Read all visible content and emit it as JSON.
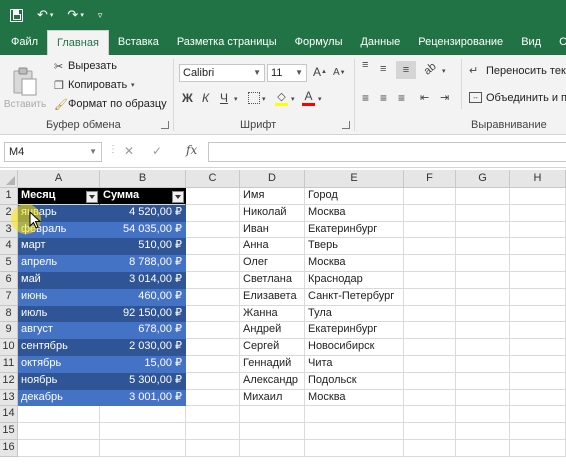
{
  "ribbon_tabs": [
    "Файл",
    "Главная",
    "Вставка",
    "Разметка страницы",
    "Формулы",
    "Данные",
    "Рецензирование",
    "Вид",
    "С"
  ],
  "active_tab": "Главная",
  "clipboard": {
    "paste": "Вставить",
    "cut": "Вырезать",
    "copy": "Копировать",
    "format_painter": "Формат по образцу",
    "label": "Буфер обмена"
  },
  "font": {
    "name": "Calibri",
    "size": "11",
    "bold": "Ж",
    "italic": "К",
    "underline": "Ч",
    "color_letter": "А",
    "label": "Шрифт"
  },
  "alignment": {
    "wrap": "Переносить текст",
    "merge": "Объединить и п",
    "label": "Выравнивание"
  },
  "formula_bar": {
    "name_box": "M4",
    "fx": "fx",
    "value": ""
  },
  "columns": [
    "A",
    "B",
    "C",
    "D",
    "E",
    "F",
    "G",
    "H"
  ],
  "rows": [
    "1",
    "2",
    "3",
    "4",
    "5",
    "6",
    "7",
    "8",
    "9",
    "10",
    "11",
    "12",
    "13",
    "14",
    "15",
    "16"
  ],
  "table": {
    "headers": [
      "Месяц",
      "Сумма"
    ],
    "rows": [
      [
        "январь",
        "4 520,00 ₽"
      ],
      [
        "февраль",
        "54 035,00 ₽"
      ],
      [
        "март",
        "510,00 ₽"
      ],
      [
        "апрель",
        "8 788,00 ₽"
      ],
      [
        "май",
        "3 014,00 ₽"
      ],
      [
        "июнь",
        "460,00 ₽"
      ],
      [
        "июль",
        "92 150,00 ₽"
      ],
      [
        "август",
        "678,00 ₽"
      ],
      [
        "сентябрь",
        "2 030,00 ₽"
      ],
      [
        "октябрь",
        "15,00 ₽"
      ],
      [
        "ноябрь",
        "5 300,00 ₽"
      ],
      [
        "декабрь",
        "3 001,00 ₽"
      ]
    ]
  },
  "people": {
    "headers": [
      "Имя",
      "Город"
    ],
    "rows": [
      [
        "Николай",
        "Москва"
      ],
      [
        "Иван",
        "Екатеринбург"
      ],
      [
        "Анна",
        "Тверь"
      ],
      [
        "Олег",
        "Москва"
      ],
      [
        "Светлана",
        "Краснодар"
      ],
      [
        "Елизавета",
        "Санкт-Петербург"
      ],
      [
        "Жанна",
        "Тула"
      ],
      [
        "Андрей",
        "Екатеринбург"
      ],
      [
        "Сергей",
        "Новосибирск"
      ],
      [
        "Геннадий",
        "Чита"
      ],
      [
        "Александр",
        "Подольск"
      ],
      [
        "Михаил",
        "Москва"
      ]
    ]
  },
  "colors": {
    "excel_green": "#217346",
    "band_dark": "#2f5597",
    "band_light": "#4472c4"
  }
}
